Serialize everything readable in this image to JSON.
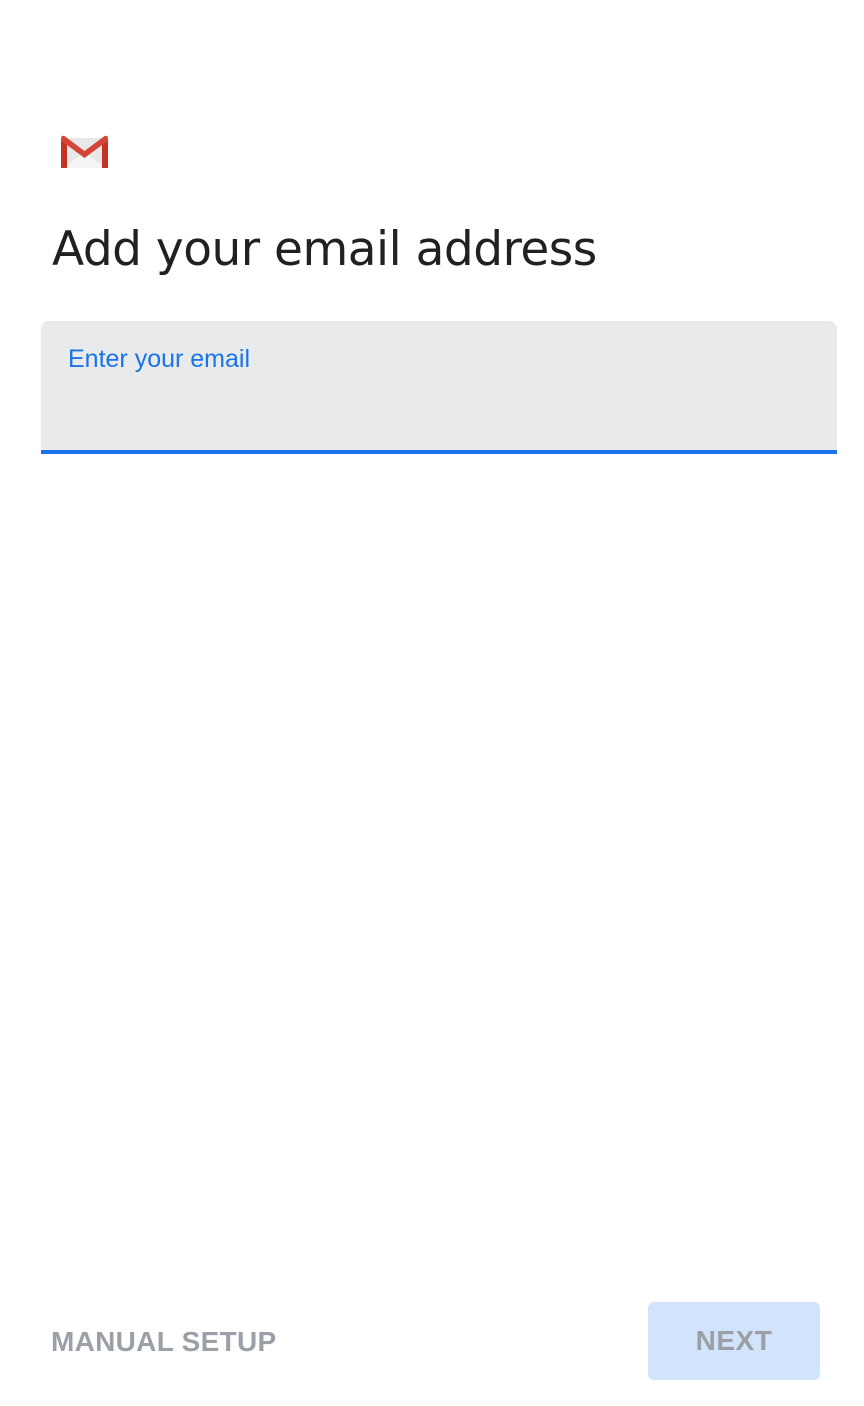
{
  "header": {
    "logo_icon": "gmail-logo-icon",
    "title": "Add your email address"
  },
  "email_field": {
    "label": "Enter your email",
    "value": "",
    "accent_color": "#1a73e8"
  },
  "footer": {
    "manual_setup_label": "MANUAL SETUP",
    "next_label": "NEXT",
    "next_enabled": false
  }
}
